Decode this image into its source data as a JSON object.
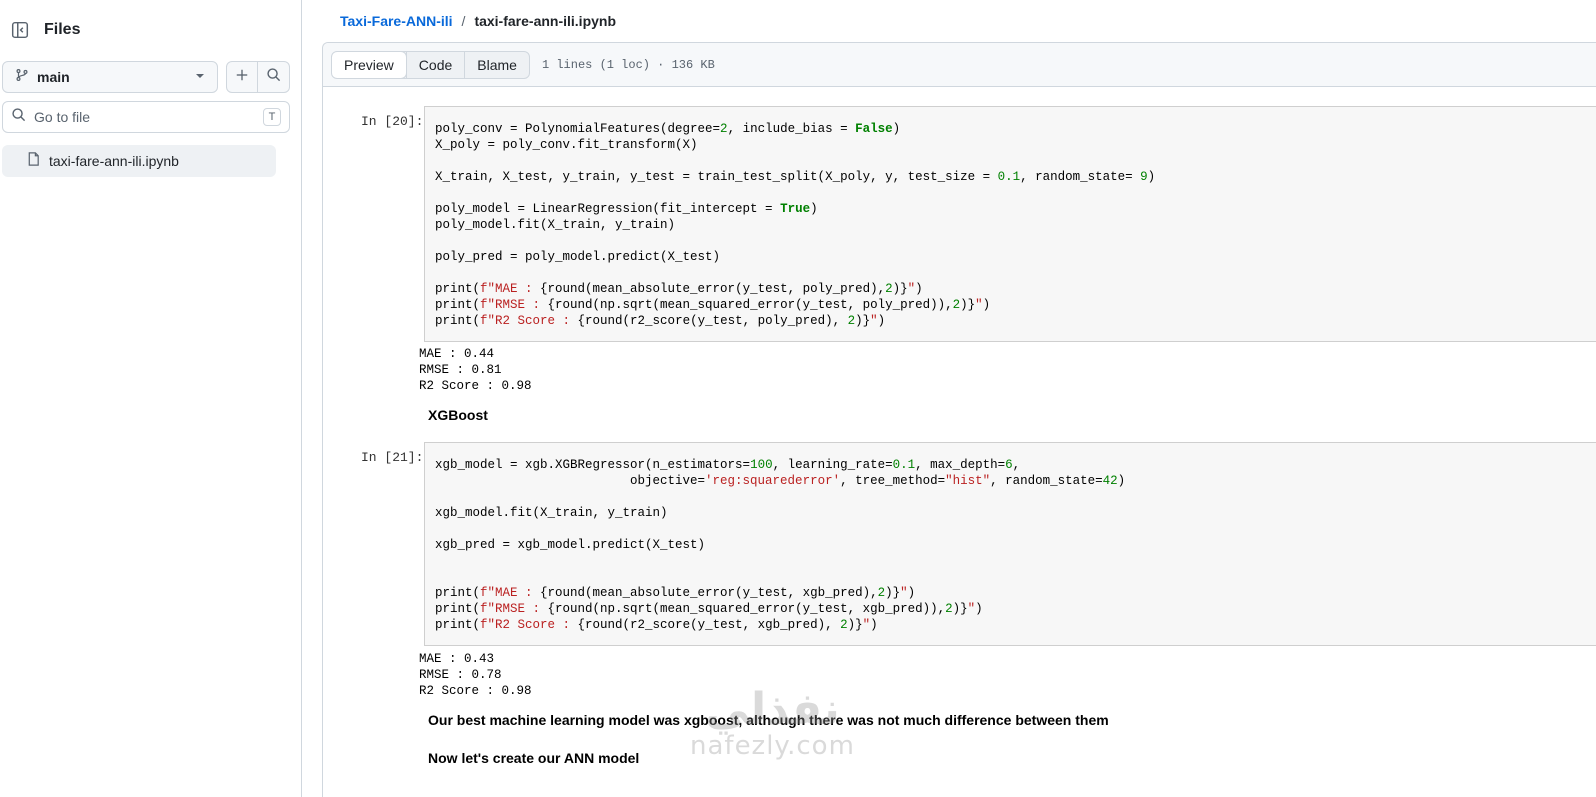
{
  "sidebar": {
    "title": "Files",
    "branch": "main",
    "search_placeholder": "Go to file",
    "search_shortcut": "T",
    "files": [
      {
        "name": "taxi-fare-ann-ili.ipynb"
      }
    ]
  },
  "breadcrumb": {
    "repo": "Taxi-Fare-ANN-ili",
    "separator": "/",
    "file": "taxi-fare-ann-ili.ipynb"
  },
  "file_header": {
    "tabs": [
      "Preview",
      "Code",
      "Blame"
    ],
    "active_tab": "Preview",
    "meta": "1 lines (1 loc) · 136 KB"
  },
  "notebook": {
    "cell20": {
      "prompt": "In [20]:",
      "output": [
        "MAE : 0.44",
        "RMSE : 0.81",
        "R2 Score : 0.98"
      ]
    },
    "heading_xgboost": "XGBoost",
    "cell21": {
      "prompt": "In [21]:",
      "output": [
        "MAE : 0.43",
        "RMSE : 0.78",
        "R2 Score : 0.98"
      ]
    },
    "md_best_model": "Our best machine learning model was xgboost, although there was not much difference between them",
    "md_ann": "Now let's create our ANN model"
  },
  "watermark": {
    "arabic": "نفذلي",
    "latin": "nafezly.com"
  },
  "icons": {
    "sidebar_toggle": "sidebar-collapse-icon",
    "branch": "git-branch-icon",
    "caret": "triangle-down-icon",
    "add": "plus-icon",
    "search": "search-icon",
    "file": "file-icon"
  }
}
